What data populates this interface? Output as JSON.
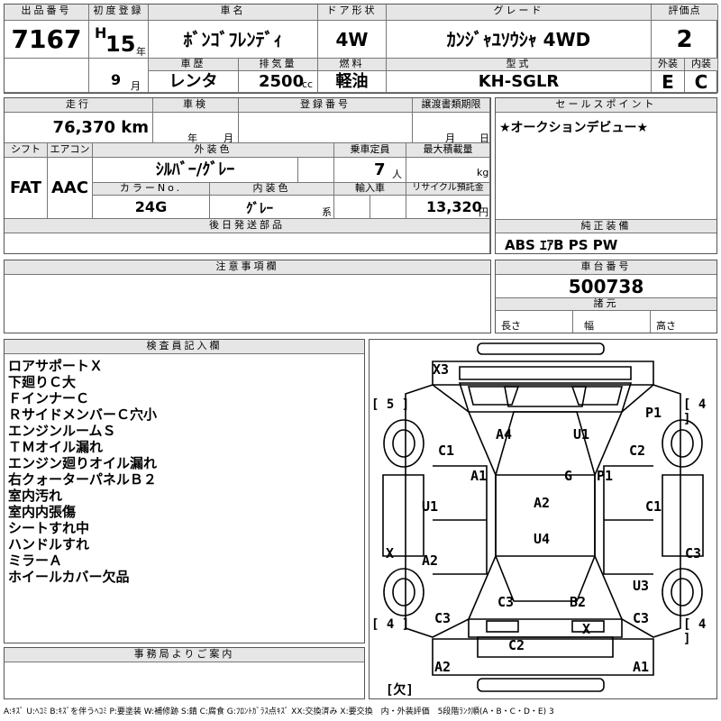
{
  "headers": {
    "lot_no": "出品番号",
    "first_reg": "初度登録",
    "car_name": "車名",
    "door_type": "ドア形状",
    "grade": "グレード",
    "score": "評価点",
    "history": "車歴",
    "displacement": "排気量",
    "fuel": "燃料",
    "model": "型式",
    "exterior": "外装",
    "interior": "内装",
    "mileage": "走行",
    "inspection": "車検",
    "reg_no": "登録番号",
    "transfer_deadline": "譲渡書類期限",
    "sales_point": "セールスポイント",
    "shift": "シフト",
    "aircon": "エアコン",
    "ext_color": "外装色",
    "capacity": "乗車定員",
    "max_load": "最大積載量",
    "color_no": "カラーNo.",
    "int_color": "内装色",
    "import": "輸入車",
    "recycle": "リサイクル預託金",
    "later_parts": "後日発送部品",
    "genuine_equipment": "純正装備",
    "caution": "注意事項欄",
    "chassis_no": "車台番号",
    "dimensions": "諸元",
    "inspector_notes": "検査員記入欄",
    "office_notice": "事務局よりご案内"
  },
  "vehicle": {
    "lot_no": "7167",
    "era": "H",
    "year": "15",
    "year_unit": "年",
    "month": "9",
    "month_unit": "月",
    "car_name": "ﾎﾞﾝｺﾞﾌﾚﾝﾃﾞｨ",
    "door_type": "4W",
    "grade": "ｶﾝｼﾞｬﾕｿｳｼｬ 4WD",
    "score": "2",
    "history": "レンタ",
    "displacement": "2500",
    "displacement_unit": "cc",
    "fuel": "軽油",
    "model": "KH-SGLR",
    "exterior_grade": "E",
    "interior_grade": "C",
    "mileage": "76,370 km",
    "inspection_year_unit": "年",
    "inspection_month_unit": "月",
    "transfer_month_unit": "月",
    "transfer_day_unit": "日",
    "sales_point": "★オークションデビュー★",
    "shift": "FAT",
    "aircon": "AAC",
    "ext_color": "ｼﾙﾊﾞｰ/ｸﾞﾚｰ",
    "capacity": "7",
    "capacity_unit": "人",
    "max_load_unit": "kg",
    "color_no": "24G",
    "int_color": "ｸﾞﾚｰ",
    "int_color_suffix": "系",
    "recycle": "13,320",
    "recycle_unit": "円",
    "genuine_equipment": "ABS ｴｱB PS PW",
    "chassis_no": "500738",
    "length_label": "長さ",
    "width_label": "幅",
    "height_label": "高さ"
  },
  "inspector_notes": [
    "ロアサポートＸ",
    "下廻りＣ大",
    "ＦインナーＣ",
    "ＲサイドメンバーＣ穴小",
    "エンジンルームＳ",
    "ＴＭオイル漏れ",
    "エンジン廻りオイル漏れ",
    "右クォーターパネルＢ２",
    "室内汚れ",
    "室内内張傷",
    "シートすれ中",
    "ハンドルすれ",
    "ミラーＡ",
    "ホイールカバー欠品"
  ],
  "diagram": {
    "tire_fl": "[ 5 ]",
    "tire_fr": "[ 4 ]",
    "tire_rl": "[ 4 ]",
    "tire_rr": "[ 4 ]",
    "spare": "[欠]",
    "marks": [
      "X3",
      "A4",
      "U1",
      "P1",
      "C1",
      "C2",
      "A1",
      "G",
      "P1",
      "U1",
      "A2",
      "C1",
      "U4",
      "X",
      "A2",
      "C3",
      "U3",
      "C3",
      "B2",
      "C3",
      "X",
      "C3",
      "C2",
      "A2",
      "A1"
    ]
  },
  "legend": "A:ｷｽﾞ U:ﾍｺﾐ B:ｷｽﾞを伴うﾍｺﾐ P:要塗装 W:補修跡 S:錆 C:腐食 G:ﾌﾛﾝﾄｶﾞﾗｽ点ｷｽﾞ XX:交換済み X:要交換　内・外装評価　5段階ﾗﾝｸ順(A・B・C・D・E) 3"
}
